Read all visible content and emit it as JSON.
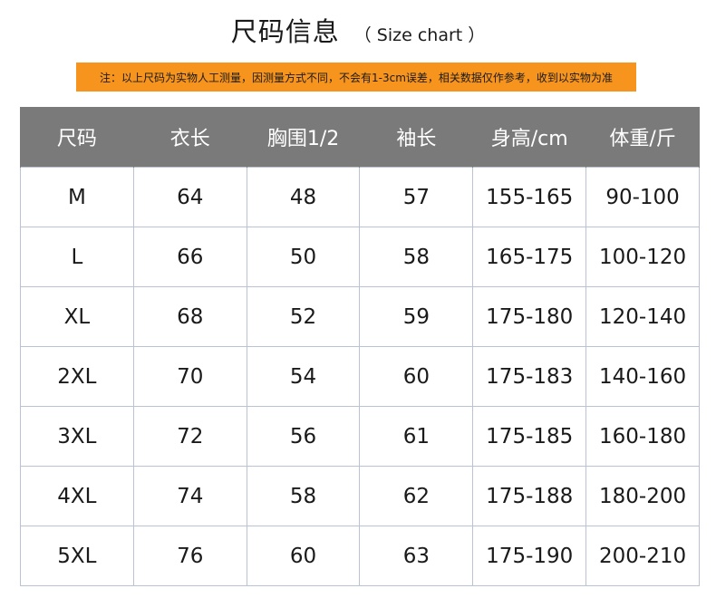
{
  "title": {
    "main": "尺码信息",
    "sub": "（ Size chart ）"
  },
  "note": "注：以上尺码为实物人工测量，因测量方式不同，不会有1-3cm误差，相关数据仅作参考，收到以实物为准",
  "colors": {
    "note_bar": "#f7941d",
    "header_bg": "#7a7a7a",
    "header_text": "#ffffff",
    "grid_line": "#b9c3d3"
  },
  "table": {
    "headers": [
      "尺码",
      "衣长",
      "胸围1/2",
      "袖长",
      "身高/cm",
      "体重/斤"
    ],
    "rows": [
      [
        "M",
        "64",
        "48",
        "57",
        "155-165",
        "90-100"
      ],
      [
        "L",
        "66",
        "50",
        "58",
        "165-175",
        "100-120"
      ],
      [
        "XL",
        "68",
        "52",
        "59",
        "175-180",
        "120-140"
      ],
      [
        "2XL",
        "70",
        "54",
        "60",
        "175-183",
        "140-160"
      ],
      [
        "3XL",
        "72",
        "56",
        "61",
        "175-185",
        "160-180"
      ],
      [
        "4XL",
        "74",
        "58",
        "62",
        "175-188",
        "180-200"
      ],
      [
        "5XL",
        "76",
        "60",
        "63",
        "175-190",
        "200-210"
      ]
    ]
  }
}
